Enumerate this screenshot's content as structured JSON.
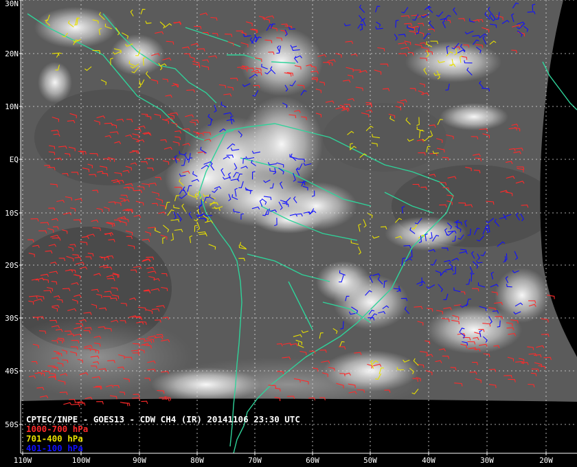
{
  "image": {
    "title": "CPTEC/INPE - GOES13 - CDW CH4 (IR) 20141106 23:30 UTC"
  },
  "legend": [
    {
      "label": "1000-700 hPa",
      "color": "#ff2a2a"
    },
    {
      "label": "701-400 hPa",
      "color": "#e8e000"
    },
    {
      "label": "401-100 hPa",
      "color": "#1010ff"
    }
  ],
  "map": {
    "coastline_color": "#2fd39a",
    "grid_color": "#e0e0e0",
    "lat_labels": [
      "30N",
      "20N",
      "10N",
      "EQ",
      "10S",
      "20S",
      "30S",
      "40S",
      "50S"
    ],
    "lon_labels": [
      "110W",
      "100W",
      "90W",
      "80W",
      "70W",
      "60W",
      "50W",
      "40W",
      "30W",
      "20W"
    ]
  }
}
